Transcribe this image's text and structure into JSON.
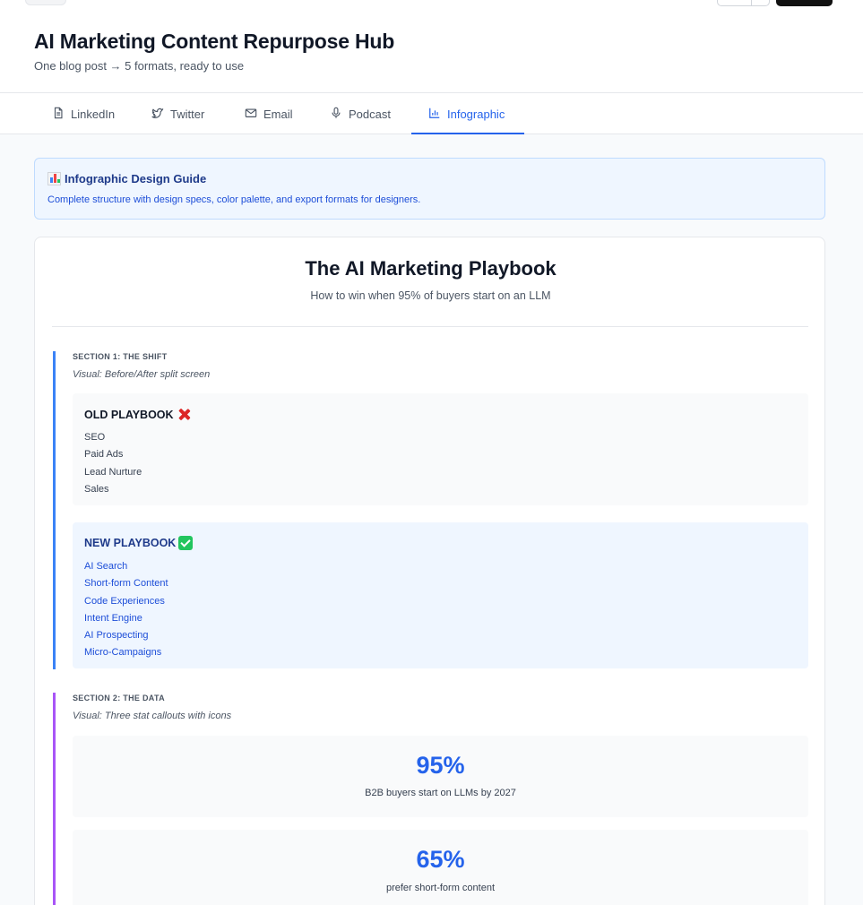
{
  "header": {
    "title": "AI Marketing Content Repurpose Hub",
    "subtitle": "One blog post → 5 formats, ready to use"
  },
  "tabs": [
    {
      "label": "LinkedIn",
      "icon": "document-icon"
    },
    {
      "label": "Twitter",
      "icon": "twitter-icon"
    },
    {
      "label": "Email",
      "icon": "mail-icon"
    },
    {
      "label": "Podcast",
      "icon": "microphone-icon"
    },
    {
      "label": "Infographic",
      "icon": "bar-chart-icon",
      "active": true
    }
  ],
  "guide": {
    "title": "Infographic Design Guide",
    "description": "Complete structure with design specs, color palette, and export formats for designers."
  },
  "infographic": {
    "title": "The AI Marketing Playbook",
    "subtitle": "How to win when 95% of buyers start on an LLM",
    "section1": {
      "label": "SECTION 1: THE SHIFT",
      "visual": "Visual: Before/After split screen",
      "old": {
        "heading": "OLD PLAYBOOK",
        "items": [
          "SEO",
          "Paid Ads",
          "Lead Nurture",
          "Sales"
        ]
      },
      "new": {
        "heading": "NEW PLAYBOOK",
        "items": [
          "AI Search",
          "Short-form Content",
          "Code Experiences",
          "Intent Engine",
          "AI Prospecting",
          "Micro-Campaigns"
        ]
      }
    },
    "section2": {
      "label": "SECTION 2: THE DATA",
      "visual": "Visual: Three stat callouts with icons",
      "stats": [
        {
          "value": "95%",
          "label": "B2B buyers start on LLMs by 2027"
        },
        {
          "value": "65%",
          "label": "prefer short-form content"
        }
      ]
    }
  },
  "colors": {
    "accent": "#2563eb",
    "section1_bar": "#3b82f6",
    "section2_bar": "#a855f7"
  }
}
